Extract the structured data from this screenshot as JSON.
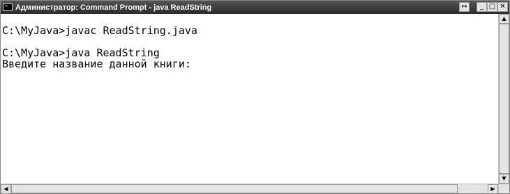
{
  "window": {
    "title": "Администратор: Command Prompt - java ReadString",
    "resize_glyph": "↔",
    "minimize_glyph": "_",
    "maximize_glyph": "□",
    "close_glyph": "✕"
  },
  "console": {
    "lines": [
      "",
      "C:\\MyJava>javac ReadString.java",
      "",
      "C:\\MyJava>java ReadString",
      "Введите название данной книги:"
    ]
  },
  "scrollbars": {
    "up_glyph": "▲",
    "down_glyph": "▼",
    "left_glyph": "◀",
    "right_glyph": "▶"
  },
  "icons": {
    "app": "cmd-icon",
    "resize": "resize-arrows-icon",
    "minimize": "minimize-icon",
    "maximize": "maximize-icon",
    "close": "close-icon"
  },
  "colors": {
    "titlebar": "#2b2b2b",
    "title_text": "#ffffff",
    "console_bg": "#ffffff",
    "console_text": "#000000"
  }
}
